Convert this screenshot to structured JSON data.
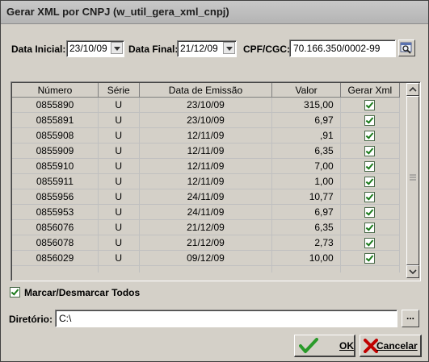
{
  "window": {
    "title": "Gerar XML por CNPJ (w_util_gera_xml_cnpj)"
  },
  "filters": {
    "data_inicial_label": "Data Inicial:",
    "data_inicial_value": "23/10/09",
    "data_final_label": "Data Final:",
    "data_final_value": "21/12/09",
    "cpf_label": "CPF/CGC:",
    "cpf_value": "70.166.350/0002-99"
  },
  "grid": {
    "columns": [
      "Número",
      "Série",
      "Data de Emissão",
      "Valor",
      "Gerar Xml"
    ],
    "rows": [
      {
        "numero": "0855890",
        "serie": "U",
        "data": "23/10/09",
        "valor": "315,00",
        "gerar": true
      },
      {
        "numero": "0855891",
        "serie": "U",
        "data": "23/10/09",
        "valor": "6,97",
        "gerar": true
      },
      {
        "numero": "0855908",
        "serie": "U",
        "data": "12/11/09",
        "valor": ",91",
        "gerar": true
      },
      {
        "numero": "0855909",
        "serie": "U",
        "data": "12/11/09",
        "valor": "6,35",
        "gerar": true
      },
      {
        "numero": "0855910",
        "serie": "U",
        "data": "12/11/09",
        "valor": "7,00",
        "gerar": true
      },
      {
        "numero": "0855911",
        "serie": "U",
        "data": "12/11/09",
        "valor": "1,00",
        "gerar": true
      },
      {
        "numero": "0855956",
        "serie": "U",
        "data": "24/11/09",
        "valor": "10,77",
        "gerar": true
      },
      {
        "numero": "0855953",
        "serie": "U",
        "data": "24/11/09",
        "valor": "6,97",
        "gerar": true
      },
      {
        "numero": "0856076",
        "serie": "U",
        "data": "21/12/09",
        "valor": "6,35",
        "gerar": true
      },
      {
        "numero": "0856078",
        "serie": "U",
        "data": "21/12/09",
        "valor": "2,73",
        "gerar": true
      },
      {
        "numero": "0856029",
        "serie": "U",
        "data": "09/12/09",
        "valor": "10,00",
        "gerar": true
      }
    ]
  },
  "marcar": {
    "label": "Marcar/Desmarcar Todos",
    "checked": true
  },
  "diretorio": {
    "label": "Diretório:",
    "value": "C:\\",
    "browse_label": "..."
  },
  "buttons": {
    "ok_label": "OK",
    "cancel_label": "Cancelar"
  },
  "colors": {
    "check_green": "#1a7a1a",
    "cancel_red": "#c00000",
    "ok_green": "#2a9a2a"
  }
}
